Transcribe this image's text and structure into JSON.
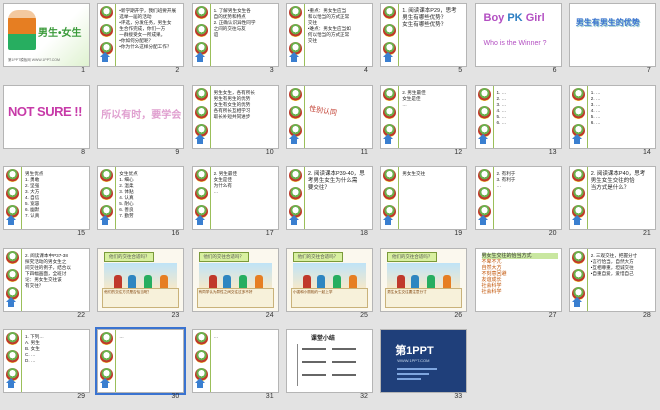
{
  "slides": [
    {
      "num": "1",
      "title": "男生•女生",
      "footer": "第1PPT模板网 WWW.1PPT.COM"
    },
    {
      "num": "2",
      "lines": [
        "•新学期开学，我们班要开展",
        "选举一届的活动",
        "•评选，分发任务，男生女",
        "生合作完成，你们一方",
        "一群接受女一所成果。",
        "•你如何分配呢？",
        "•你为什么这样分配工作？"
      ]
    },
    {
      "num": "3",
      "lines": [
        "1. 了解男生女生各",
        "自的优势和特点",
        "2. 正确认识异性同学",
        "之间的交往与友",
        "谊"
      ]
    },
    {
      "num": "4",
      "lines": [
        "•重点：男女生应当",
        "和以恰当的方式正常",
        "交往",
        "•难点：男女生应当如",
        "何以恰当的方式正常",
        "交往"
      ]
    },
    {
      "num": "5",
      "lines": [
        "1. 阅读课本P29，思考",
        "男生有哪些优势？",
        "女生有哪些优势？"
      ]
    },
    {
      "num": "6",
      "title1": "Boy",
      "title2": "PK",
      "title3": "Girl",
      "subtitle": "Who is the Winner ?"
    },
    {
      "num": "7",
      "title": "男生有男生的优势"
    },
    {
      "num": "8",
      "title": "NOT SURE !!"
    },
    {
      "num": "9",
      "title": "所以有时，要学会"
    },
    {
      "num": "10",
      "lines": [
        "男生女生，各有所长",
        "男生有男生的优势",
        "女生有女生的优势",
        "各有所长互相学习",
        "取长补短共同进步"
      ]
    },
    {
      "num": "11",
      "title": "性别认同"
    },
    {
      "num": "12",
      "lines": [
        "2. 男生最佳",
        "女生是佳",
        "…"
      ]
    },
    {
      "num": "13",
      "lines": [
        "1. …",
        "2. …",
        "3. …",
        "4. …",
        "5. …",
        "6. …"
      ]
    },
    {
      "num": "14",
      "lines": [
        "1. …",
        "2. …",
        "3. …",
        "4. …",
        "5. …",
        "6. …"
      ]
    },
    {
      "num": "15",
      "lines": [
        "男生优点",
        "1. 勇敢",
        "2. 坚强",
        "3. 大方",
        "4. 自信",
        "5. 宽容",
        "6. 幽默",
        "7. 认真"
      ]
    },
    {
      "num": "16",
      "lines": [
        "女生优点",
        "1. 细心",
        "2. 温柔",
        "3. 体贴",
        "4. 认真",
        "5. 耐心",
        "6. 善良",
        "7. 勤劳"
      ]
    },
    {
      "num": "17",
      "lines": [
        "2. 男生最佳",
        "女生是佳",
        "为什么有",
        "…"
      ]
    },
    {
      "num": "18",
      "lines": [
        "2. 阅读课本P39-40，思",
        "考男生女生为什么需",
        "要交往？"
      ]
    },
    {
      "num": "19",
      "lines": [
        "男女生交往"
      ]
    },
    {
      "num": "20",
      "lines": [
        "2. 有利于",
        "3. 有利于",
        "…"
      ]
    },
    {
      "num": "21",
      "lines": [
        "2. 阅读课本P40，思考",
        "男生女生交往的恰",
        "当方式是什么？"
      ]
    },
    {
      "num": "22",
      "lines": [
        "2. 阅读课本中P37-38",
        "探究活动的男女生之",
        "间交往的例子，结合以",
        "下四幅画面，全班讨",
        "论：男女生交往该",
        "有交往？"
      ]
    },
    {
      "num": "23",
      "banner": "他们的交往合适吗？",
      "caption": "他们的交往方式是否恰当呢？"
    },
    {
      "num": "24",
      "banner": "他们的交往合适吗？",
      "caption": "有同学认为异性之间交往过多不好"
    },
    {
      "num": "25",
      "banner": "他们的交往合适吗？",
      "caption": "小强和小丽相约一起上学"
    },
    {
      "num": "26",
      "banner": "他们的交往合适吗？",
      "caption": "男生女生交往要注意分寸"
    },
    {
      "num": "27",
      "lines": [
        "男女生交往的恰当方式",
        "不卑不亢",
        "自然大方",
        "不刻意回避",
        "友谊成长",
        "社会科学",
        "社会科学"
      ]
    },
    {
      "num": "28",
      "lines": [
        "2. 三观交往，把握分寸",
        "•言行恰当，自然大方",
        "•互相尊重，坦诚交往",
        "•自重自爱，爱惜自己"
      ]
    },
    {
      "num": "29",
      "lines": [
        "1. 下列…",
        "A. 男生",
        "B. 女生",
        "C. …",
        "D. …"
      ]
    },
    {
      "num": "30",
      "lines": [
        "…"
      ]
    },
    {
      "num": "31",
      "lines": [
        "…"
      ]
    },
    {
      "num": "32",
      "title": "课堂小结"
    },
    {
      "num": "33",
      "title": "第1PPT",
      "subtitle": "WWW.1PPT.COM"
    }
  ]
}
